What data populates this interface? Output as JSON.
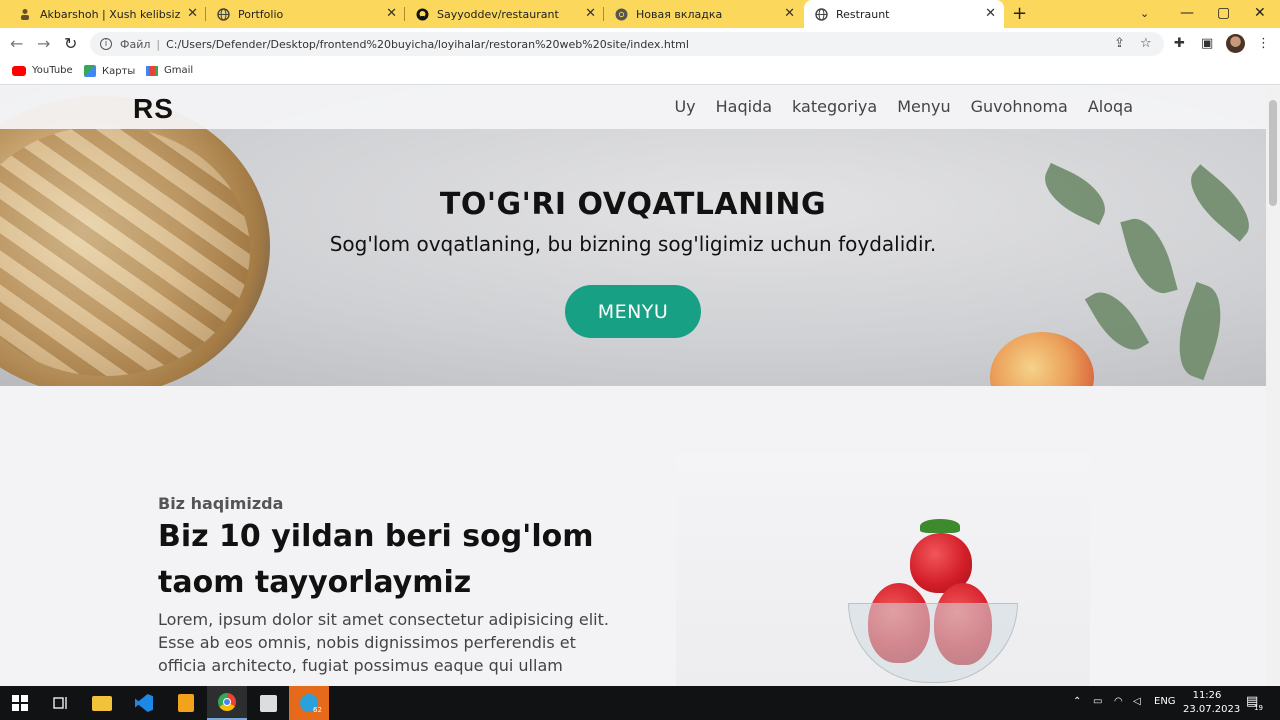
{
  "browser": {
    "tabs": [
      {
        "title": "Akbarshoh | Xush kelibsiz",
        "icon": "person-icon"
      },
      {
        "title": "Portfolio",
        "icon": "globe-icon"
      },
      {
        "title": "Sayyoddev/restaurant",
        "icon": "github-icon"
      },
      {
        "title": "Новая вкладка",
        "icon": "chrome-icon"
      },
      {
        "title": "Restraunt",
        "icon": "globe-icon",
        "active": true
      }
    ],
    "address": {
      "scheme_label": "Файл",
      "url": "C:/Users/Defender/Desktop/frontend%20buyicha/loyihalar/restoran%20web%20site/index.html"
    },
    "bookmarks": [
      "YouTube",
      "Карты",
      "Gmail"
    ],
    "accent_color": "#fbd85c"
  },
  "site": {
    "logo": "RS",
    "nav": [
      "Uy",
      "Haqida",
      "kategoriya",
      "Menyu",
      "Guvohnoma",
      "Aloqa"
    ],
    "hero": {
      "title": "TO'G'RI OVQATLANING",
      "subtitle": "Sog'lom ovqatlaning, bu bizning sog'ligimiz uchun foydalidir.",
      "button": "MENYU",
      "button_color": "#17a083"
    },
    "about": {
      "eyebrow": "Biz haqimizda",
      "title": "Biz 10 yildan beri sog'lom taom tayyorlaymiz",
      "text": "Lorem, ipsum dolor sit amet consectetur adipisicing elit. Esse ab eos omnis, nobis dignissimos perferendis et officia architecto, fugiat possimus eaque qui ullam"
    }
  },
  "taskbar": {
    "telegram_badge": "62",
    "language": "ENG",
    "time": "11:26",
    "date": "23.07.2023",
    "notifications": "19"
  }
}
